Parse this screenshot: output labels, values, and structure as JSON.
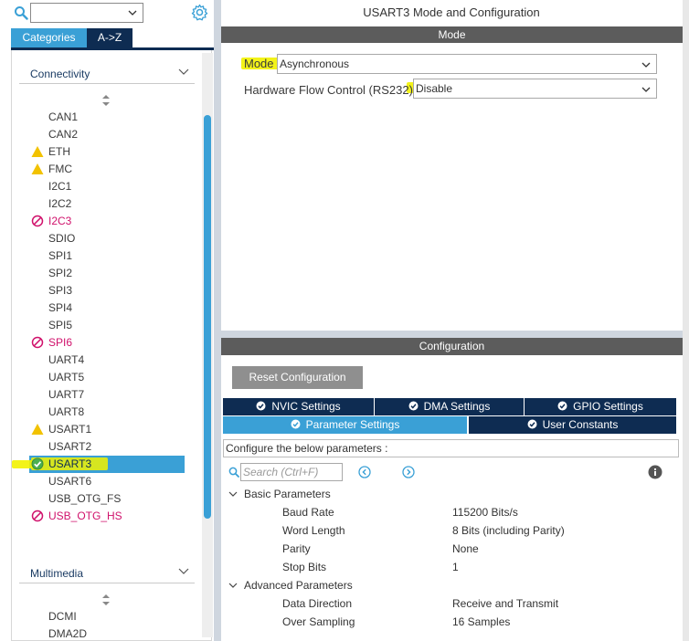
{
  "left": {
    "search_value": "",
    "tabs": [
      "Categories",
      "A->Z"
    ],
    "groups": [
      {
        "label": "Connectivity"
      },
      {
        "label": "Multimedia"
      }
    ],
    "connectivity_items": [
      {
        "label": "CAN1",
        "status": "none"
      },
      {
        "label": "CAN2",
        "status": "none"
      },
      {
        "label": "ETH",
        "status": "warning"
      },
      {
        "label": "FMC",
        "status": "warning"
      },
      {
        "label": "I2C1",
        "status": "none"
      },
      {
        "label": "I2C2",
        "status": "none"
      },
      {
        "label": "I2C3",
        "status": "blocked"
      },
      {
        "label": "SDIO",
        "status": "none"
      },
      {
        "label": "SPI1",
        "status": "none"
      },
      {
        "label": "SPI2",
        "status": "none"
      },
      {
        "label": "SPI3",
        "status": "none"
      },
      {
        "label": "SPI4",
        "status": "none"
      },
      {
        "label": "SPI5",
        "status": "none"
      },
      {
        "label": "SPI6",
        "status": "blocked"
      },
      {
        "label": "UART4",
        "status": "none"
      },
      {
        "label": "UART5",
        "status": "none"
      },
      {
        "label": "UART7",
        "status": "none"
      },
      {
        "label": "UART8",
        "status": "none"
      },
      {
        "label": "USART1",
        "status": "warning"
      },
      {
        "label": "USART2",
        "status": "none"
      },
      {
        "label": "USART3",
        "status": "ok"
      },
      {
        "label": "USART6",
        "status": "none"
      },
      {
        "label": "USB_OTG_FS",
        "status": "none"
      },
      {
        "label": "USB_OTG_HS",
        "status": "blocked"
      }
    ],
    "multimedia_items": [
      {
        "label": "DCMI"
      },
      {
        "label": "DMA2D"
      }
    ],
    "selected_item": "USART3"
  },
  "right": {
    "title": "USART3 Mode and Configuration",
    "mode_band": "Mode",
    "mode_label": "Mode",
    "mode_value": "Asynchronous",
    "flow_label": "Hardware Flow Control (RS232)",
    "flow_value": "Disable",
    "config_band": "Configuration",
    "reset_button": "Reset Configuration",
    "tabs_row1": [
      "NVIC Settings",
      "DMA Settings",
      "GPIO Settings"
    ],
    "tabs_row2": [
      "Parameter Settings",
      "User Constants"
    ],
    "active_tab": "Parameter Settings",
    "configure_text": "Configure the below parameters :",
    "search_placeholder": "Search (Ctrl+F)",
    "basic_group": "Basic Parameters",
    "basic_params": [
      {
        "name": "Baud Rate",
        "value": "115200 Bits/s"
      },
      {
        "name": "Word Length",
        "value": "8 Bits (including Parity)"
      },
      {
        "name": "Parity",
        "value": "None"
      },
      {
        "name": "Stop Bits",
        "value": "1"
      }
    ],
    "advanced_group": "Advanced Parameters",
    "advanced_params": [
      {
        "name": "Data Direction",
        "value": "Receive and Transmit"
      },
      {
        "name": "Over Sampling",
        "value": "16 Samples"
      }
    ]
  },
  "colors": {
    "accent_blue": "#3aa0d6",
    "navy": "#0e2c52",
    "band_gray": "#5c5c5c",
    "highlighter": "#f2f200",
    "warning": "#f2c200",
    "blocked": "#d0116b",
    "ok": "#4caf50"
  }
}
